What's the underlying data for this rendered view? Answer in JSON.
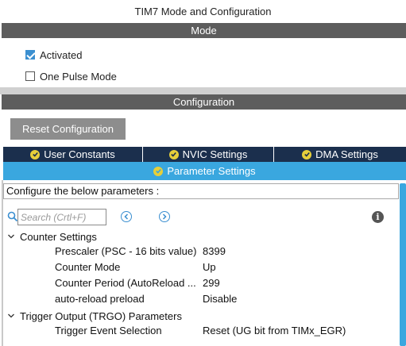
{
  "window": {
    "title": "TIM7 Mode and Configuration"
  },
  "mode": {
    "header": "Mode",
    "activated": {
      "label": "Activated",
      "checked": true
    },
    "one_pulse": {
      "label": "One Pulse Mode",
      "checked": false
    }
  },
  "configuration": {
    "header": "Configuration",
    "reset_label": "Reset Configuration",
    "tabs": [
      {
        "label": "User Constants",
        "icon": "check-circle-icon"
      },
      {
        "label": "NVIC Settings",
        "icon": "check-circle-icon"
      },
      {
        "label": "DMA Settings",
        "icon": "check-circle-icon"
      }
    ],
    "active_tab": {
      "label": "Parameter Settings",
      "icon": "check-circle-icon"
    },
    "configure_text": "Configure the below parameters :",
    "search": {
      "placeholder": "Search (Crtl+F)",
      "value": ""
    },
    "groups": [
      {
        "label": "Counter Settings",
        "params": [
          {
            "label": "Prescaler (PSC - 16 bits value)",
            "value": "8399"
          },
          {
            "label": "Counter Mode",
            "value": "Up"
          },
          {
            "label": "Counter Period (AutoReload ...",
            "value": "299"
          },
          {
            "label": "auto-reload preload",
            "value": "Disable"
          }
        ]
      },
      {
        "label": "Trigger Output (TRGO) Parameters",
        "params": [
          {
            "label": "Trigger Event Selection",
            "value": "Reset (UG bit from TIMx_EGR)"
          }
        ]
      }
    ]
  },
  "colors": {
    "section_bar": "#5d5d5d",
    "tab_dark": "#1b2f4d",
    "tab_active": "#3aa7df",
    "check_accent": "#3b8fd0",
    "ok_icon": "#e6cf3a"
  }
}
